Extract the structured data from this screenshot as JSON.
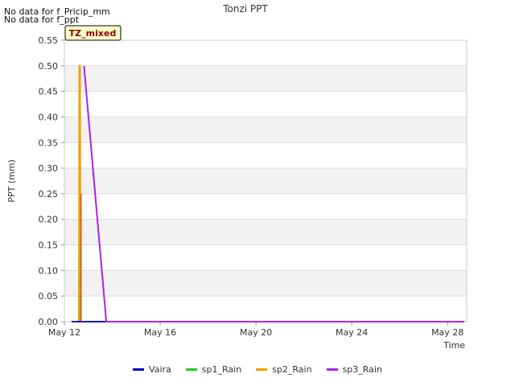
{
  "header": {
    "nodata_lines": [
      "No data for f_Pricip_mm",
      "No data for f_ppt"
    ],
    "badge": "TZ_mixed"
  },
  "chart_data": {
    "type": "line",
    "title": "Tonzi PPT",
    "xlabel": "Time",
    "ylabel": "PPT (mm)",
    "ylim": [
      0,
      0.55
    ],
    "yticks": [
      "0.00",
      "0.05",
      "0.10",
      "0.15",
      "0.20",
      "0.25",
      "0.30",
      "0.35",
      "0.40",
      "0.45",
      "0.50",
      "0.55"
    ],
    "xlim": [
      0,
      16.8
    ],
    "xticks": [
      {
        "label": "May 12",
        "value": 0
      },
      {
        "label": "May 16",
        "value": 4
      },
      {
        "label": "May 20",
        "value": 8
      },
      {
        "label": "May 24",
        "value": 12
      },
      {
        "label": "May 28",
        "value": 16
      }
    ],
    "grid": true,
    "legend_position": "bottom",
    "series": [
      {
        "name": "Vaira",
        "color": "#0000cc",
        "x": [
          0.3,
          16.7
        ],
        "y": [
          0,
          0
        ]
      },
      {
        "name": "sp1_Rain",
        "color": "#22cc22",
        "x": [
          0.55,
          0.62,
          0.64,
          0.66,
          0.7,
          16.7
        ],
        "y": [
          0,
          0,
          0.25,
          0,
          0,
          0
        ]
      },
      {
        "name": "sp2_Rain",
        "color": "#f0a000",
        "x": [
          0.3,
          0.6,
          0.62,
          0.66,
          0.68,
          1.7,
          16.7
        ],
        "y": [
          0,
          0,
          0.5,
          0.5,
          0,
          0,
          0
        ]
      },
      {
        "name": "sp3_Rain",
        "color": "#aa22ee",
        "x": [
          0.82,
          1.75,
          16.7
        ],
        "y": [
          0.5,
          0,
          0
        ]
      }
    ],
    "annotations": [
      {
        "name": "thin-red-spike",
        "color": "#cc2222",
        "x": [
          0.7,
          0.7
        ],
        "y": [
          0,
          0.25
        ]
      }
    ]
  }
}
